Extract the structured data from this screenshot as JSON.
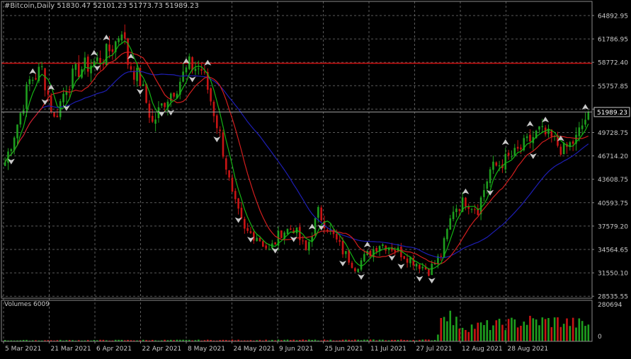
{
  "window": {
    "symbol": "#Bitcoin,Daily",
    "ohlc": "51830.47 52101.23 51773.73 51989.23"
  },
  "price_axis": {
    "labels": [
      "64892.95",
      "61786.95",
      "58772.40",
      "55757.85",
      "52743.30",
      "49728.75",
      "46714.20",
      "43608.75",
      "40593.75",
      "37579.20",
      "34564.65",
      "31550.10",
      "28535.55"
    ],
    "current_price": "51989.23",
    "range": [
      27900,
      66300
    ]
  },
  "volume_axis": {
    "label": "Volumes 6009",
    "max_label": "280694",
    "zero_label": "0"
  },
  "time_axis": {
    "labels": [
      "5 Mar 2021",
      "21 Mar 2021",
      "6 Apr 2021",
      "22 Apr 2021",
      "8 May 2021",
      "24 May 2021",
      "9 Jun 2021",
      "25 Jun 2021",
      "11 Jul 2021",
      "27 Jul 2021",
      "12 Aug 2021",
      "28 Aug 2021"
    ]
  },
  "horizontal_level": {
    "price": 58300,
    "color": "#d01010"
  },
  "colors": {
    "up": "#1e9e1e",
    "down": "#c81414",
    "grid": "#5a5a5a",
    "ma_fast": "#14b414",
    "ma_mid": "#d21e1e",
    "ma_slow": "#1e1eb4",
    "axis_text": "#c8c8c8",
    "price_tag_bg": "#000000",
    "fractal": "#c8c8c8"
  },
  "chart_data": {
    "type": "candlestick",
    "close_anchors": [
      [
        0,
        45500
      ],
      [
        4,
        50500
      ],
      [
        8,
        56000
      ],
      [
        12,
        57500
      ],
      [
        16,
        51000
      ],
      [
        20,
        55500
      ],
      [
        24,
        57500
      ],
      [
        28,
        58200
      ],
      [
        32,
        59000
      ],
      [
        36,
        61000
      ],
      [
        38,
        63000
      ],
      [
        40,
        58500
      ],
      [
        44,
        56000
      ],
      [
        48,
        50500
      ],
      [
        52,
        53500
      ],
      [
        56,
        55500
      ],
      [
        60,
        58000
      ],
      [
        64,
        57500
      ],
      [
        66,
        55000
      ],
      [
        70,
        49000
      ],
      [
        74,
        41000
      ],
      [
        78,
        36500
      ],
      [
        82,
        36000
      ],
      [
        86,
        34000
      ],
      [
        90,
        36500
      ],
      [
        94,
        37000
      ],
      [
        98,
        34000
      ],
      [
        102,
        39000
      ],
      [
        106,
        36500
      ],
      [
        110,
        34000
      ],
      [
        114,
        32000
      ],
      [
        118,
        33500
      ],
      [
        122,
        35000
      ],
      [
        126,
        34500
      ],
      [
        130,
        33500
      ],
      [
        134,
        32500
      ],
      [
        138,
        31500
      ],
      [
        142,
        33500
      ],
      [
        146,
        39500
      ],
      [
        150,
        40500
      ],
      [
        154,
        39500
      ],
      [
        158,
        44500
      ],
      [
        162,
        45500
      ],
      [
        166,
        46500
      ],
      [
        170,
        48000
      ],
      [
        174,
        49500
      ],
      [
        178,
        48500
      ],
      [
        182,
        47000
      ],
      [
        186,
        48500
      ],
      [
        190,
        51989.23
      ]
    ],
    "volume_anchors": [
      [
        0,
        0.03
      ],
      [
        140,
        0.04
      ],
      [
        141,
        0.25
      ],
      [
        143,
        0.95
      ],
      [
        146,
        0.55
      ],
      [
        150,
        0.4
      ],
      [
        160,
        0.45
      ],
      [
        170,
        0.55
      ],
      [
        180,
        0.55
      ],
      [
        190,
        0.45
      ]
    ],
    "ma_periods": {
      "fast": 5,
      "mid": 13,
      "slow": 34
    },
    "fractals_up": [
      9,
      15,
      29,
      33,
      41,
      59,
      66,
      100,
      118,
      150,
      163,
      171,
      176,
      181,
      189
    ],
    "fractals_down": [
      2,
      13,
      20,
      30,
      44,
      51,
      54,
      61,
      69,
      76,
      80,
      88,
      94,
      103,
      110,
      116,
      126,
      129,
      135,
      139,
      158,
      172
    ]
  }
}
